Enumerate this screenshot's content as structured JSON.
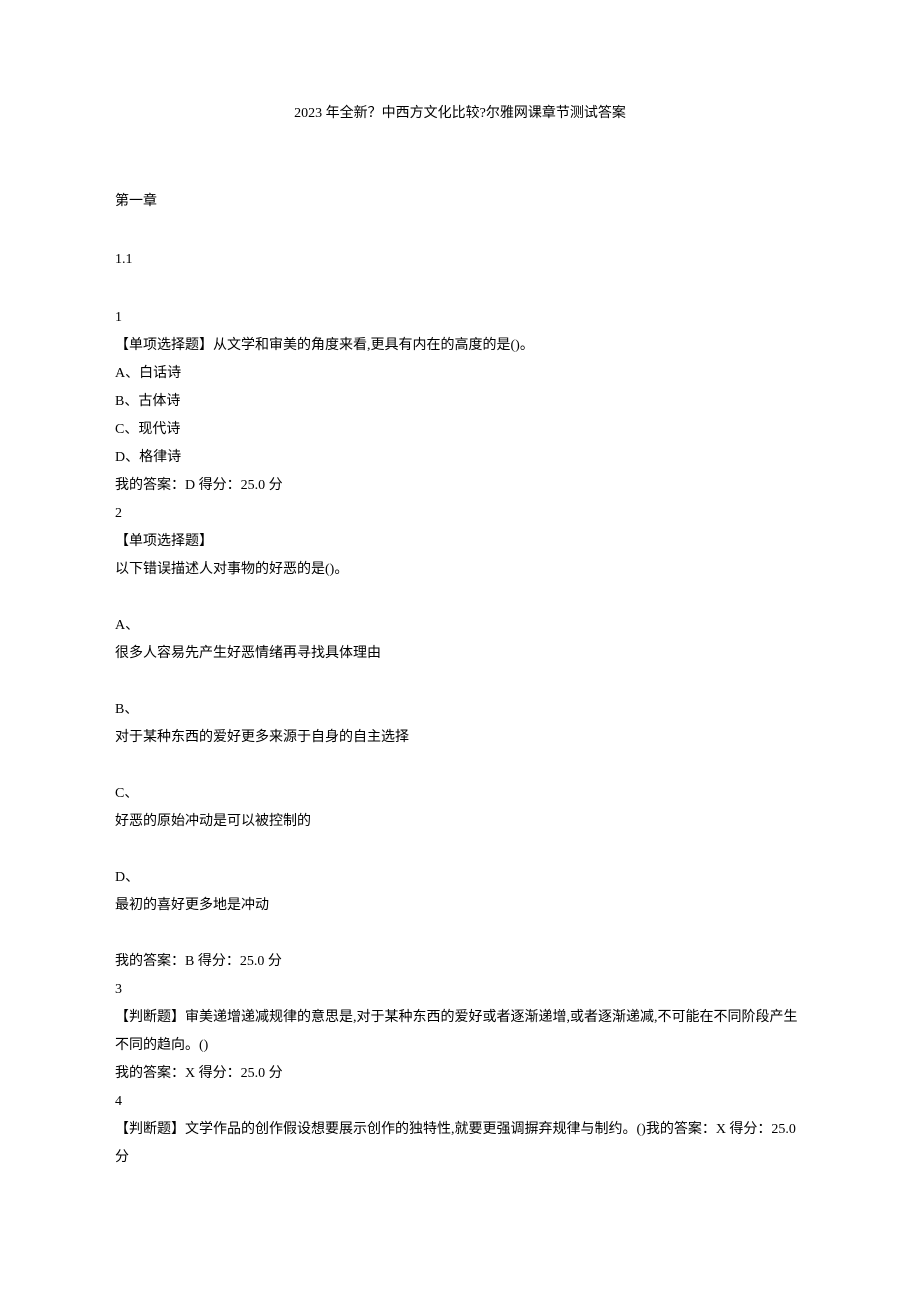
{
  "title": "2023 年全新？中西方文化比较?尔雅网课章节测试答案",
  "chapterLabel": "第一章",
  "sectionLabel": "1.1",
  "q1": {
    "number": "1",
    "stem": "【单项选择题】从文学和审美的角度来看,更具有内在的高度的是()。",
    "a": "A、白话诗",
    "b": "B、古体诗",
    "c": "C、现代诗",
    "d": "D、格律诗",
    "answer": "我的答案：D 得分：25.0 分"
  },
  "q2": {
    "number": "2",
    "type": "【单项选择题】",
    "stem": "以下错误描述人对事物的好恶的是()。",
    "aLabel": "A、",
    "aText": "很多人容易先产生好恶情绪再寻找具体理由",
    "bLabel": "B、",
    "bText": "对于某种东西的爱好更多来源于自身的自主选择",
    "cLabel": "C、",
    "cText": "好恶的原始冲动是可以被控制的",
    "dLabel": "D、",
    "dText": "最初的喜好更多地是冲动",
    "answer": "我的答案：B 得分：25.0 分"
  },
  "q3": {
    "number": "3",
    "stem": "【判断题】审美递增递减规律的意思是,对于某种东西的爱好或者逐渐递增,或者逐渐递减,不可能在不同阶段产生不同的趋向。()",
    "answer": "我的答案：X 得分：25.0 分"
  },
  "q4": {
    "number": "4",
    "stem": "【判断题】文学作品的创作假设想要展示创作的独特性,就要更强调摒弃规律与制约。()我的答案：X 得分：25.0 分"
  }
}
